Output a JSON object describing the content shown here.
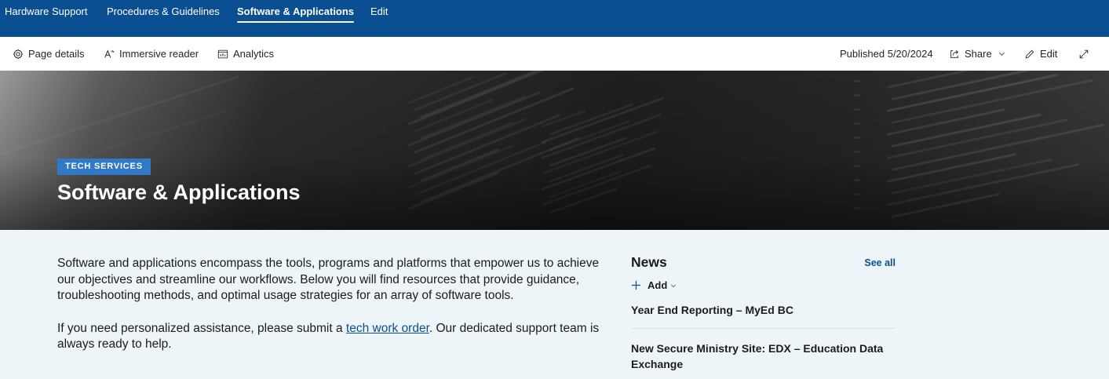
{
  "topnav": {
    "items": [
      {
        "label": "Hardware Support",
        "active": false
      },
      {
        "label": "Procedures & Guidelines",
        "active": false
      },
      {
        "label": "Software & Applications",
        "active": true
      },
      {
        "label": "Edit",
        "active": false
      }
    ]
  },
  "commandbar": {
    "page_details": "Page details",
    "immersive_reader": "Immersive reader",
    "analytics": "Analytics",
    "published": "Published 5/20/2024",
    "share": "Share",
    "edit": "Edit"
  },
  "hero": {
    "tag": "TECH SERVICES",
    "title": "Software & Applications"
  },
  "main": {
    "para1": "Software and applications encompass the tools, programs and platforms that empower us to achieve our objectives and streamline our workflows. Below you will find resources that provide guidance, troubleshooting methods, and optimal usage strategies for an array of software tools.",
    "para2_before": "If you need personalized assistance, please submit a ",
    "para2_link": "tech work order",
    "para2_after": ". Our dedicated support team is always ready to help."
  },
  "news": {
    "title": "News",
    "see_all": "See all",
    "add": "Add",
    "items": [
      {
        "title": "Year End Reporting – MyEd BC"
      },
      {
        "title": "New Secure Ministry Site: EDX – Education Data Exchange"
      }
    ]
  },
  "colors": {
    "nav_bg": "#0b4f93",
    "tag_bg": "#2f79c8",
    "link": "#0b4f93",
    "content_bg": "#eef5f9"
  }
}
